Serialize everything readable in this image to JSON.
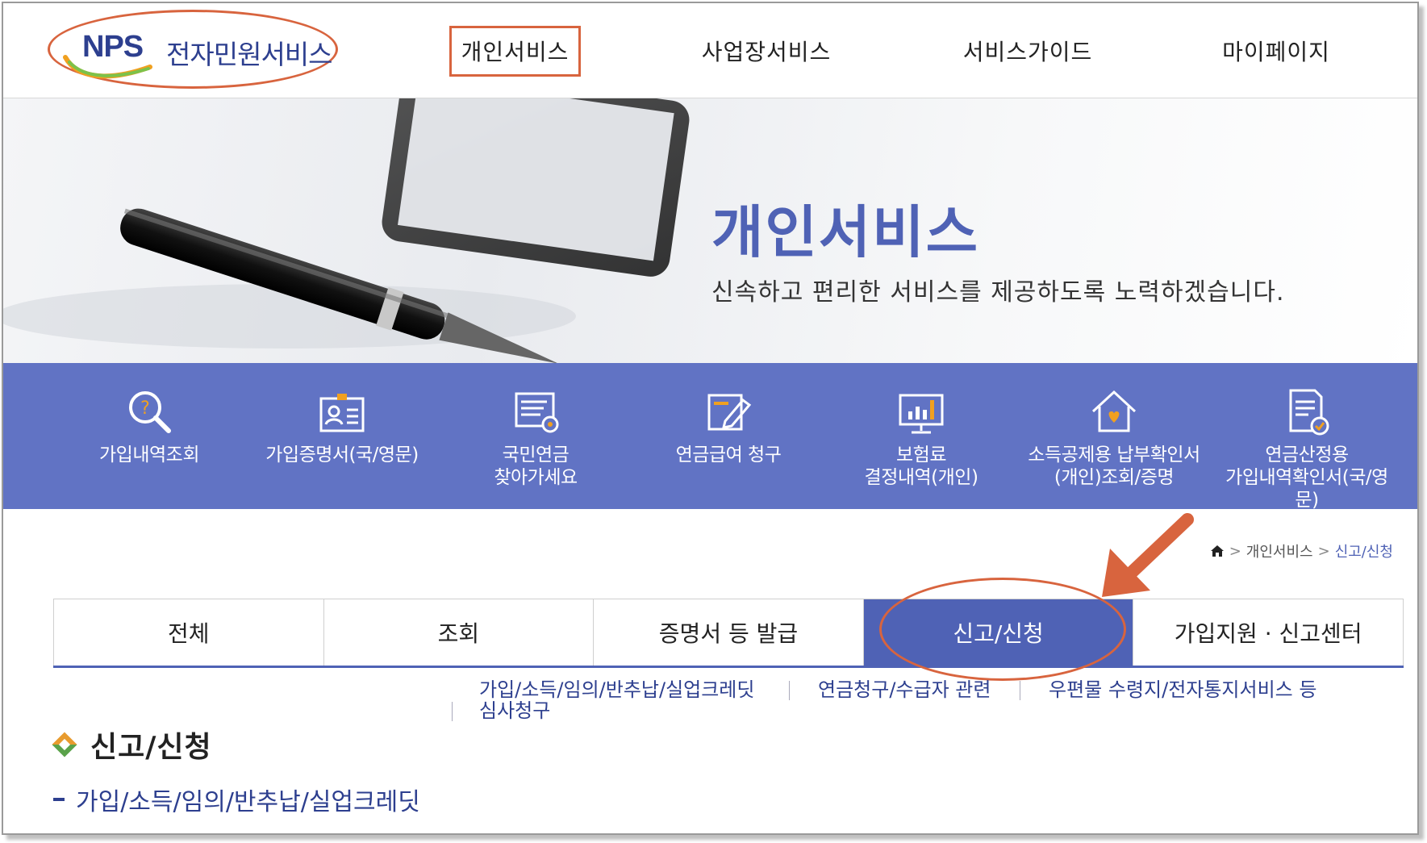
{
  "logo": {
    "brand": "NPS",
    "title": "전자민원서비스"
  },
  "gnb": {
    "personal": "개인서비스",
    "business": "사업장서비스",
    "guide": "서비스가이드",
    "mypage": "마이페이지"
  },
  "hero": {
    "title": "개인서비스",
    "subtitle": "신속하고 편리한 서비스를 제공하도록 노력하겠습니다."
  },
  "quick_menu": [
    {
      "line1": "가입내역조회",
      "line2": "",
      "icon": "search-icon"
    },
    {
      "line1": "가입증명서(국/영문)",
      "line2": "",
      "icon": "id-card-icon"
    },
    {
      "line1": "국민연금",
      "line2": "찾아가세요",
      "icon": "document-search-icon"
    },
    {
      "line1": "연금급여 청구",
      "line2": "",
      "icon": "edit-document-icon"
    },
    {
      "line1": "보험료",
      "line2": "결정내역(개인)",
      "icon": "monitor-chart-icon"
    },
    {
      "line1": "소득공제용 납부확인서",
      "line2": "(개인)조회/증명",
      "icon": "house-icon"
    },
    {
      "line1": "연금산정용",
      "line2": "가입내역확인서(국/영문)",
      "icon": "certificate-icon"
    }
  ],
  "breadcrumb": {
    "level1": "개인서비스",
    "level2": "신고/신청"
  },
  "tabs": [
    {
      "label": "전체"
    },
    {
      "label": "조회"
    },
    {
      "label": "증명서 등 발급"
    },
    {
      "label": "신고/신청"
    },
    {
      "label": "가입지원 · 신고센터"
    }
  ],
  "active_tab": "신고/신청",
  "subnav": {
    "item1_line1": "가입/소득/임의/반추납/실업크레딧",
    "item1_line2": "심사청구",
    "item2": "연금청구/수급자 관련",
    "item3": "우편물 수령지/전자통지서비스 등"
  },
  "section": {
    "title": "신고/신청",
    "sub_title": "가입/소득/임의/반추납/실업크레딧"
  },
  "colors": {
    "brand_blue": "#4f62b5",
    "band_blue": "#6173c4",
    "highlight_orange": "#d8643e"
  }
}
